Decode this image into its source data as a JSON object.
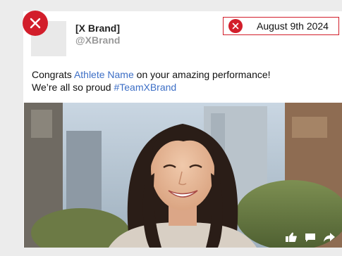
{
  "post": {
    "brand_name": "[X Brand]",
    "handle": "@XBrand",
    "date": "August 9th 2024",
    "caption": {
      "line1_prefix": "Congrats ",
      "athlete_link": "Athlete Name",
      "line1_suffix": " on your amazing performance!",
      "line2_prefix": "We’re all so proud ",
      "hashtag": "#TeamXBrand"
    }
  },
  "icons": {
    "close": "close-icon",
    "date_close": "close-icon",
    "like": "thumbs-up-icon",
    "comment": "comment-icon",
    "share": "share-icon"
  },
  "colors": {
    "accent_red": "#d21e2b",
    "link_blue": "#3d6fc6",
    "handle_gray": "#9a9a9a",
    "background": "#ececec"
  }
}
